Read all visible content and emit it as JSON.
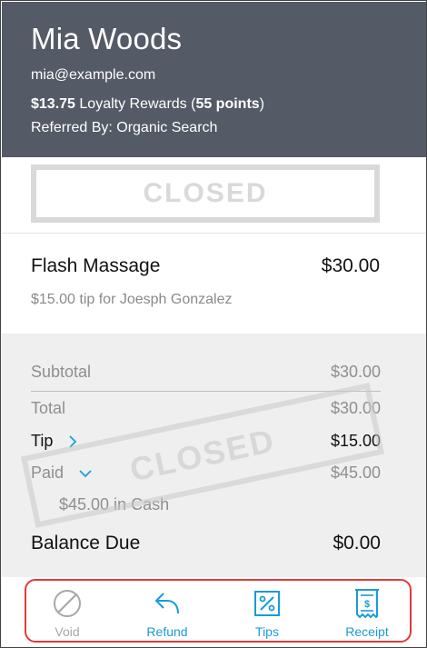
{
  "customer": {
    "name": "Mia Woods",
    "email": "mia@example.com",
    "loyalty_amount": "$13.75",
    "loyalty_text": "Loyalty Rewards (",
    "loyalty_points": "55 points",
    "loyalty_close": ")",
    "referred": "Referred By: Organic Search"
  },
  "status": {
    "label": "CLOSED"
  },
  "service": {
    "name": "Flash Massage",
    "price": "$30.00",
    "tip_note": "$15.00 tip for Joesph Gonzalez"
  },
  "summary": {
    "subtotal_label": "Subtotal",
    "subtotal_value": "$30.00",
    "total_label": "Total",
    "total_value": "$30.00",
    "tip_label": "Tip",
    "tip_value": "$15.00",
    "paid_label": "Paid",
    "paid_value": "$45.00",
    "cash_line": "$45.00 in Cash",
    "balance_label": "Balance Due",
    "balance_value": "$0.00"
  },
  "actions": {
    "void_label": "Void",
    "refund_label": "Refund",
    "tips_label": "Tips",
    "receipt_label": "Receipt"
  },
  "colors": {
    "header_bg": "#545a66",
    "accent": "#1a9bd8",
    "highlight_border": "#e03a3a"
  },
  "icons": {
    "void": "void-circle-icon",
    "refund": "undo-arrow-icon",
    "tips": "percent-icon",
    "receipt": "receipt-dollar-icon",
    "tip_chevron": "chevron-right-icon",
    "paid_chevron": "chevron-down-icon"
  }
}
